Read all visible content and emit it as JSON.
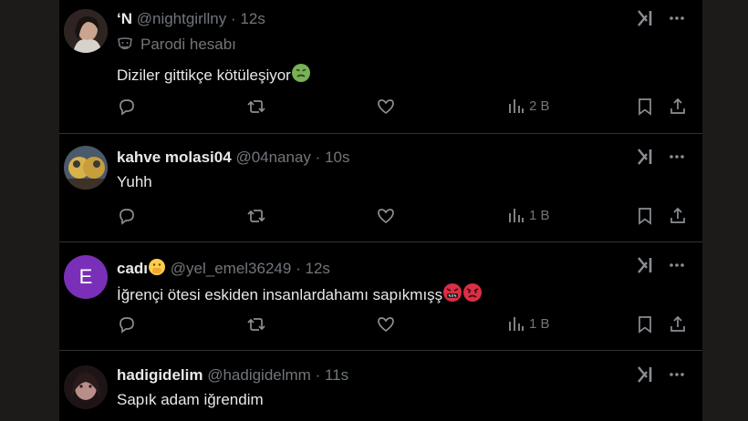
{
  "tweets": [
    {
      "name": "‘N",
      "handle": "@nightgirllny",
      "separator": "·",
      "time": "12s",
      "badge_label": "Parodi hesabı",
      "text": "Diziler gittikçe kötüleşiyor",
      "views": "2 B",
      "emoji": "nauseated-face"
    },
    {
      "name": "kahve molasi04",
      "handle": "@04nanay",
      "separator": "·",
      "time": "10s",
      "text": "Yuhh",
      "views": "1 B"
    },
    {
      "name": "cadı",
      "handle": "@yel_emel36249",
      "separator": "·",
      "time": "12s",
      "text": "İğrençi ötesi eskiden insanlardahamı sapıkmışş",
      "views": "1 B",
      "avatar_letter": "E",
      "name_emoji": "face-with-hand-over-mouth",
      "emojis": [
        "cursing-face",
        "angry-face"
      ]
    },
    {
      "name": "hadigidelim",
      "handle": "@hadigidelmm",
      "separator": "·",
      "time": "11s",
      "text": "Sapık adam iğrendim"
    }
  ],
  "colors": {
    "background": "#000000",
    "text": "#e7e9ea",
    "muted": "#71767b",
    "divider": "#2f3336",
    "avatar_letter_bg": "#7a2fb8"
  }
}
